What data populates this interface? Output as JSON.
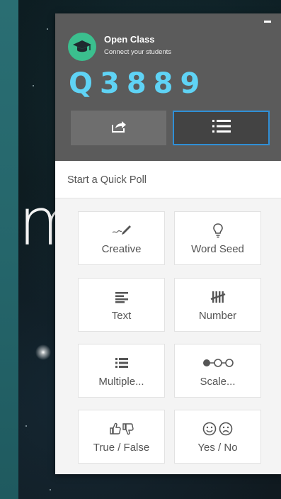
{
  "header": {
    "title": "Open Class",
    "subtitle": "Connect your students",
    "code": "Q3889",
    "share_icon": "share-icon",
    "list_icon": "list-icon",
    "colors": {
      "header_bg": "#5b5b5b",
      "code": "#5fd3f5",
      "logo": "#3bbf8e",
      "active_border": "#2f8fd6"
    }
  },
  "quick_poll": {
    "label": "Start a Quick Poll",
    "options": [
      {
        "label": "Creative",
        "icon": "pen-sparkle-icon"
      },
      {
        "label": "Word Seed",
        "icon": "lightbulb-icon"
      },
      {
        "label": "Text",
        "icon": "text-lines-icon"
      },
      {
        "label": "Number",
        "icon": "tally-marks-icon"
      },
      {
        "label": "Multiple...",
        "icon": "list-icon"
      },
      {
        "label": "Scale...",
        "icon": "scale-dots-icon"
      },
      {
        "label": "True / False",
        "icon": "thumbs-up-down-icon"
      },
      {
        "label": "Yes / No",
        "icon": "smiley-frowny-icon"
      }
    ]
  },
  "background": {
    "glyph": "m"
  }
}
